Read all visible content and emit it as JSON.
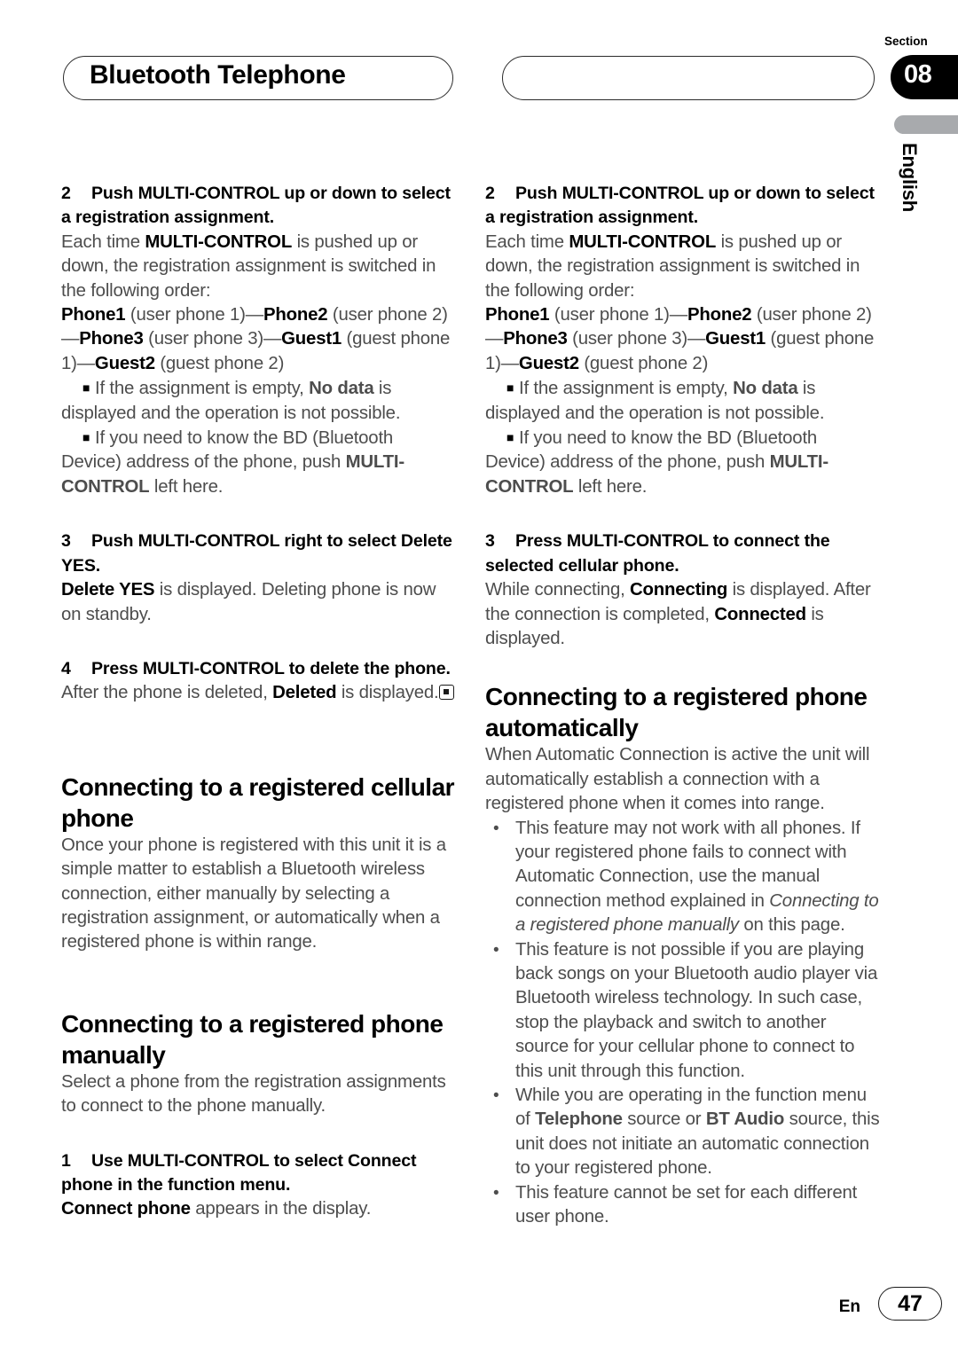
{
  "header": {
    "title": "Bluetooth Telephone",
    "section_label": "Section",
    "section_number": "08",
    "language_tab": "English"
  },
  "footer": {
    "language_code": "En",
    "page_number": "47"
  },
  "left_column": {
    "step2_heading_num": "2",
    "step2_heading_text": "Push MULTI-CONTROL up or down to select a registration assignment.",
    "step2_body_1_a": "Each time ",
    "step2_body_1_b": "MULTI-CONTROL",
    "step2_body_1_c": " is pushed up or down, the registration assignment is switched in the following order:",
    "order_p1": "Phone1",
    "order_p1_desc": " (user phone 1)—",
    "order_p2": "Phone2",
    "order_p2_desc": " (user phone 2)—",
    "order_p3": "Phone3",
    "order_p3_desc": " (user phone 3)—",
    "order_g1": "Guest1",
    "order_g1_desc": " (guest phone 1)—",
    "order_g2": "Guest2",
    "order_g2_desc": " (guest phone 2)",
    "note1_a": "If the assignment is empty, ",
    "note1_b": "No data",
    "note1_c": " is displayed and the operation is not possible.",
    "note2_a": "If you need to know the BD (Bluetooth Device) address of the phone, push ",
    "note2_b": "MULTI-CONTROL",
    "note2_c": " left here.",
    "step3_heading_num": "3",
    "step3_heading_text": "Push MULTI-CONTROL right to select Delete YES.",
    "step3_body_a": "Delete YES",
    "step3_body_b": " is displayed. Deleting phone is now on standby.",
    "step4_heading_num": "4",
    "step4_heading_text": "Press MULTI-CONTROL to delete the phone.",
    "step4_body_a": "After the phone is deleted, ",
    "step4_body_b": "Deleted",
    "step4_body_c": " is displayed.",
    "heading_registered": "Connecting to a registered cellular phone",
    "para_registered": "Once your phone is registered with this unit it is a simple matter to establish a Bluetooth wireless connection, either manually by selecting a registration assignment, or automatically when a registered phone is within range.",
    "heading_manually": "Connecting to a registered phone manually",
    "para_manually": "Select a phone from the registration assignments to connect to the phone manually.",
    "step1_heading_num": "1",
    "step1_heading_text": "Use MULTI-CONTROL to select Connect phone in the function menu.",
    "step1_body_a": "Connect phone",
    "step1_body_b": " appears in the display."
  },
  "right_column": {
    "step2_heading_num": "2",
    "step2_heading_text": "Push MULTI-CONTROL up or down to select a registration assignment.",
    "step2_body_1_a": "Each time ",
    "step2_body_1_b": "MULTI-CONTROL",
    "step2_body_1_c": " is pushed up or down, the registration assignment is switched in the following order:",
    "order_p1": "Phone1",
    "order_p1_desc": " (user phone 1)—",
    "order_p2": "Phone2",
    "order_p2_desc": " (user phone 2)—",
    "order_p3": "Phone3",
    "order_p3_desc": " (user phone 3)—",
    "order_g1": "Guest1",
    "order_g1_desc": " (guest phone 1)—",
    "order_g2": "Guest2",
    "order_g2_desc": " (guest phone 2)",
    "note1_a": "If the assignment is empty, ",
    "note1_b": "No data",
    "note1_c": " is displayed and the operation is not possible.",
    "note2_a": "If you need to know the BD (Bluetooth Device) address of the phone, push ",
    "note2_b": "MULTI-CONTROL",
    "note2_c": " left here.",
    "step3_heading_num": "3",
    "step3_heading_text": "Press MULTI-CONTROL to connect the selected cellular phone.",
    "step3_body_a": "While connecting, ",
    "step3_body_b": "Connecting",
    "step3_body_c": " is displayed. After the connection is completed, ",
    "step3_body_d": "Connected",
    "step3_body_e": " is displayed.",
    "heading_auto": "Connecting to a registered phone automatically",
    "para_auto": "When Automatic Connection is active the unit will automatically establish a connection with a registered phone when it comes into range.",
    "bullet1_a": "This feature may not work with all phones. If your registered phone fails to connect with Automatic Connection, use the manual connection method explained in ",
    "bullet1_italic": "Connecting to a registered phone manually",
    "bullet1_b": " on this page.",
    "bullet2": "This feature is not possible if you are playing back songs on your Bluetooth audio player via Bluetooth wireless technology. In such case, stop the playback and switch to another source for your cellular phone to connect to this unit through this function.",
    "bullet3_a": "While you are operating in the function menu of ",
    "bullet3_b": "Telephone",
    "bullet3_c": " source or ",
    "bullet3_d": "BT Audio",
    "bullet3_e": " source, this unit does not initiate an automatic connection to your registered phone.",
    "bullet4": "This feature cannot be set for each different user phone."
  },
  "symbols": {
    "square_bullet": "■",
    "round_bullet": "•"
  },
  "colors": {
    "body_text": "#4d4d4d",
    "bold_text": "#000000",
    "section_tab_bg": "#000000",
    "language_bar": "#a8aaad",
    "page_bg": "#ffffff"
  }
}
